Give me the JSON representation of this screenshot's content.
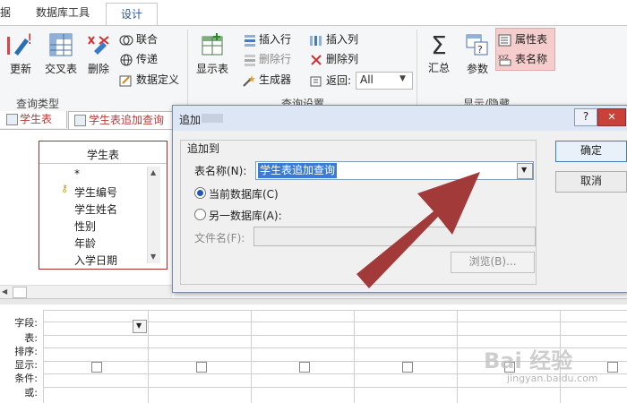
{
  "ribbon_tabs": {
    "data": "据",
    "db_tools": "数据库工具",
    "design": "设计"
  },
  "ribbon": {
    "refresh": "更新",
    "crosstab": "交叉表",
    "delete": "删除",
    "union": "联合",
    "pass_through": "传递",
    "data_definition": "数据定义",
    "group_query_type": "查询类型",
    "show_table": "显示表",
    "insert_row": "插入行",
    "delete_row": "删除行",
    "builder": "生成器",
    "insert_column": "插入列",
    "delete_column": "删除列",
    "return_label": "返回:",
    "return_value": "All",
    "group_query_setup": "查询设置",
    "totals": "汇总",
    "parameters": "参数",
    "property_sheet": "属性表",
    "table_names": "表名称",
    "group_show_hide": "显示/隐藏"
  },
  "doc_tabs": [
    "学生表",
    "学生表追加查询"
  ],
  "table_box": {
    "title": "学生表",
    "fields": [
      "*",
      "学生编号",
      "学生姓名",
      "性别",
      "年龄",
      "入学日期"
    ]
  },
  "dialog": {
    "title": "追加",
    "help": "?",
    "close": "✕",
    "section": "追加到",
    "table_name_label": "表名称(N):",
    "table_name_value": "学生表追加查询",
    "current_db": "当前数据库(C)",
    "other_db": "另一数据库(A):",
    "file_name_label": "文件名(F):",
    "browse": "浏览(B)...",
    "ok": "确定",
    "cancel": "取消"
  },
  "grid": {
    "row_labels": [
      "字段:",
      "表:",
      "排序:",
      "显示:",
      "条件:",
      "或:"
    ],
    "show_checked": [
      false,
      false,
      false,
      false,
      false,
      false
    ]
  },
  "watermark": {
    "brand": "Bai 经验",
    "url": "jingyan.baidu.com"
  },
  "colors": {
    "arrow": "#a23a3a",
    "accent": "#2b579a",
    "table_border": "#a03030"
  }
}
